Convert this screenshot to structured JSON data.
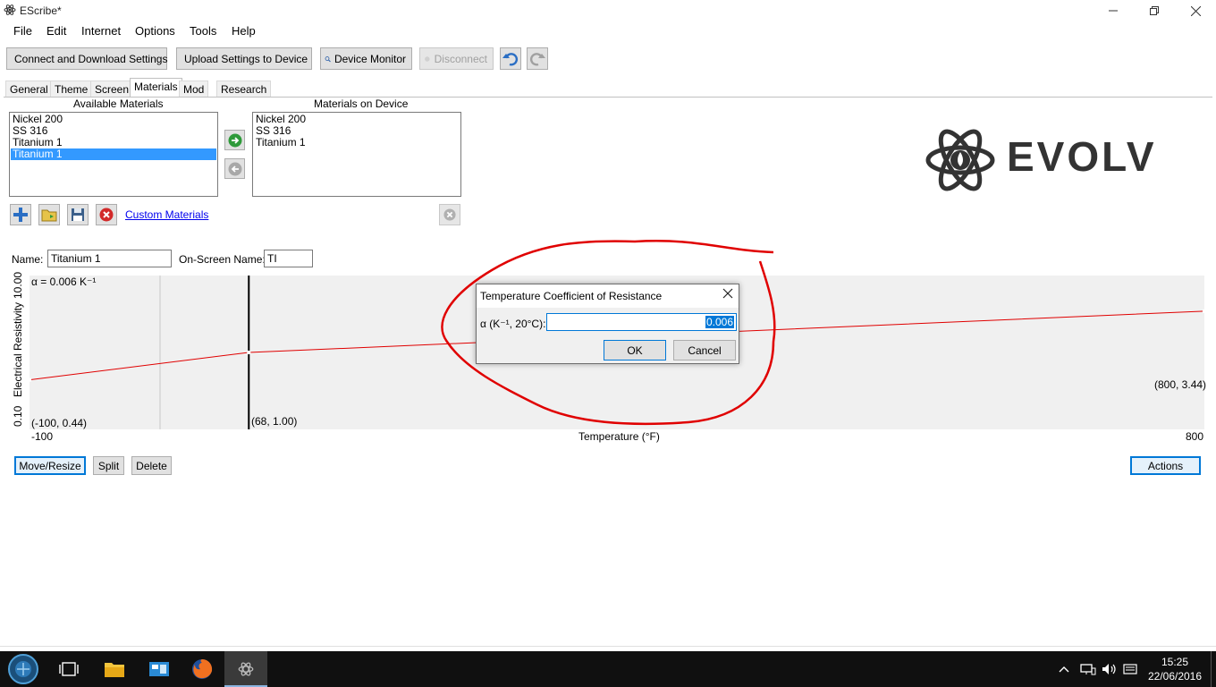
{
  "window": {
    "title": "EScribe*"
  },
  "menu": [
    "File",
    "Edit",
    "Internet",
    "Options",
    "Tools",
    "Help"
  ],
  "toolbar": {
    "connect": "Connect and Download Settings",
    "upload": "Upload Settings to Device",
    "monitor": "Device Monitor",
    "disconnect": "Disconnect"
  },
  "tabs": [
    "General",
    "Theme",
    "Screen",
    "Materials",
    "Mod",
    "Research"
  ],
  "materials": {
    "available_title": "Available Materials",
    "device_title": "Materials on Device",
    "available": [
      "Nickel 200",
      "SS 316",
      "Titanium 1",
      "Titanium 1"
    ],
    "available_selected": 3,
    "device": [
      "Nickel 200",
      "SS 316",
      "Titanium 1"
    ],
    "custom_link": "Custom Materials",
    "name_label": "Name:",
    "name_value": "Titanium 1",
    "onscreen_label": "On-Screen Name:",
    "onscreen_value": "TI"
  },
  "brand": {
    "logo_text": "EVOLV"
  },
  "plot": {
    "alpha_label": "α = 0.006 K⁻¹",
    "y_axis_label": "Electrical Resistivity",
    "y_max": "10.00",
    "y_min": "0.10",
    "x_min": "-100",
    "x_max": "800",
    "x_label": "Temperature (°F)",
    "point_left": "(-100, 0.44)",
    "point_mid": "(68, 1.00)",
    "point_right": "(800, 3.44)",
    "line_color": "#e00000"
  },
  "chart_data": {
    "type": "line",
    "xlabel": "Temperature (°F)",
    "ylabel": "Electrical Resistivity",
    "xlim": [
      -100,
      800
    ],
    "ylim": [
      0.1,
      10.0
    ],
    "series": [
      {
        "x": [
          -100,
          68,
          800
        ],
        "y": [
          0.44,
          1.0,
          3.44
        ]
      }
    ]
  },
  "plot_buttons": {
    "move": "Move/Resize",
    "split": "Split",
    "delete": "Delete",
    "actions": "Actions"
  },
  "dialog": {
    "title": "Temperature Coefficient of Resistance",
    "label": "α (K⁻¹, 20°C):",
    "value": "0.006",
    "ok": "OK",
    "cancel": "Cancel"
  },
  "annotation": {
    "color": "#e00000"
  },
  "taskbar": {
    "time": "15:25",
    "date": "22/06/2016"
  }
}
